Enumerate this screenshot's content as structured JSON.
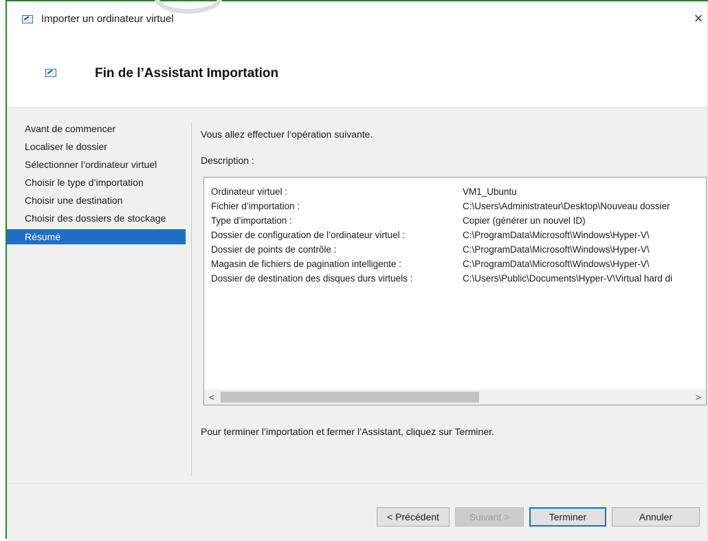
{
  "window": {
    "title": "Importer un ordinateur virtuel",
    "close_label": "×"
  },
  "header": {
    "title": "Fin de l’Assistant Importation"
  },
  "sidebar": {
    "items": [
      {
        "label": "Avant de commencer",
        "active": false
      },
      {
        "label": "Localiser le dossier",
        "active": false
      },
      {
        "label": "Sélectionner l’ordinateur virtuel",
        "active": false
      },
      {
        "label": "Choisir le type d’importation",
        "active": false
      },
      {
        "label": "Choisir une destination",
        "active": false
      },
      {
        "label": "Choisir des dossiers de stockage",
        "active": false
      },
      {
        "label": "Résumé",
        "active": true
      }
    ]
  },
  "main": {
    "intro": "Vous allez effectuer l’opération suivante.",
    "description_label": "Description :",
    "summary": [
      {
        "key": "Ordinateur virtuel :",
        "value": "VM1_Ubuntu"
      },
      {
        "key": "Fichier d’importation :",
        "value": "C:\\Users\\Administrateur\\Desktop\\Nouveau dossier"
      },
      {
        "key": "Type d’importation :",
        "value": "Copier (générer un nouvel ID)"
      },
      {
        "key": "Dossier de configuration de l’ordinateur virtuel :",
        "value": "C:\\ProgramData\\Microsoft\\Windows\\Hyper-V\\"
      },
      {
        "key": "Dossier de points de contrôle :",
        "value": "C:\\ProgramData\\Microsoft\\Windows\\Hyper-V\\"
      },
      {
        "key": "Magasin de fichiers de pagination intelligente :",
        "value": "C:\\ProgramData\\Microsoft\\Windows\\Hyper-V\\"
      },
      {
        "key": "Dossier de destination des disques durs virtuels :",
        "value": "C:\\Users\\Public\\Documents\\Hyper-V\\Virtual hard di"
      }
    ],
    "scroll_left": "<",
    "scroll_right": ">",
    "finish_text": "Pour terminer l’importation et fermer l’Assistant, cliquez sur Terminer."
  },
  "footer": {
    "prev_label": "< Précédent",
    "next_label": "Suivant >",
    "finish_label": "Terminer",
    "cancel_label": "Annuler"
  },
  "colors": {
    "accent": "#1f6fc6",
    "window_border": "#2e7d32",
    "default_button_border": "#0078d7"
  }
}
